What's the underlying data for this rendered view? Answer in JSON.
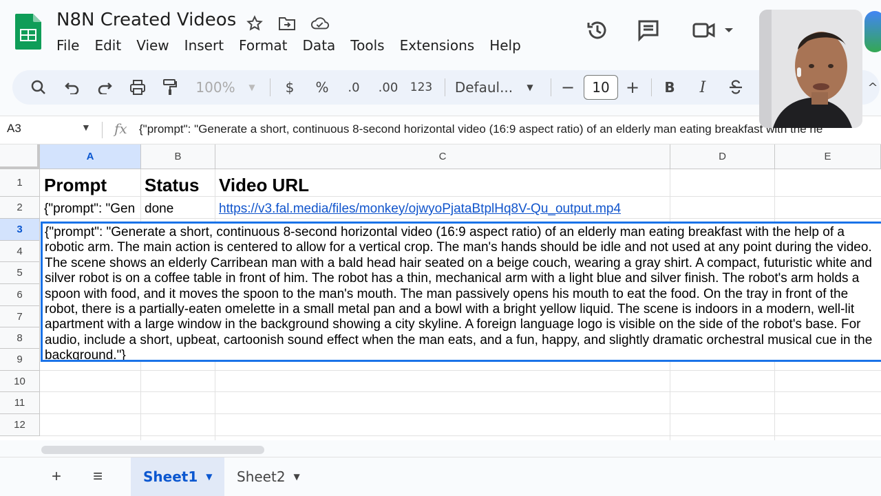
{
  "app": {
    "title": "N8N Created Videos",
    "icons": [
      "sheets-logo-icon",
      "star-icon",
      "move-to-folder-icon",
      "cloud-saved-icon"
    ]
  },
  "menu": [
    "File",
    "Edit",
    "View",
    "Insert",
    "Format",
    "Data",
    "Tools",
    "Extensions",
    "Help"
  ],
  "header_actions": [
    "history-icon",
    "comments-icon",
    "meet-icon",
    "meet-dropdown-icon"
  ],
  "toolbar": {
    "zoom": "100%",
    "currency": "$",
    "percent": "%",
    "decrease_decimals": ".0",
    "increase_decimals": ".00",
    "number_format": "123",
    "font": "Defaul...",
    "font_size": "10",
    "minus": "−",
    "plus": "+",
    "bold": "B",
    "italic": "I",
    "collapse": "^"
  },
  "formula_bar": {
    "name_box": "A3",
    "fx": "fx",
    "content": "{\"prompt\": \"Generate a short, continuous 8-second horizontal video (16:9 aspect ratio) of an elderly man eating breakfast with the he"
  },
  "columns": [
    "A",
    "B",
    "C",
    "D",
    "E"
  ],
  "rows": [
    "1",
    "2",
    "3",
    "4",
    "5",
    "6",
    "7",
    "8",
    "9",
    "10",
    "11",
    "12"
  ],
  "cells": {
    "a1": "Prompt",
    "b1": "Status",
    "c1": "Video URL",
    "a2": "{\"prompt\": \"Gen",
    "b2": "done",
    "c2": "https://v3.fal.media/files/monkey/ojwyoPjataBtplHq8V-Qu_output.mp4",
    "a3": "{\"prompt\": \"Generate a short, continuous 8-second horizontal video (16:9 aspect ratio) of an elderly man eating breakfast with the help of a\nrobotic arm. The main action is centered to allow for a vertical crop. The man's hands should be idle and not used at any point during the video.\nThe scene shows an elderly Carribean man with a bald head hair seated on a beige couch, wearing a gray shirt. A compact, futuristic white and\nsilver robot is on a coffee table in front of him. The robot has a thin, mechanical arm with a light blue and silver finish. The robot's arm holds a\nspoon with food, and it moves the spoon to the man's mouth. The man passively opens his mouth to eat the food. On the tray in front of the\nrobot, there is a partially-eaten omelette in a small metal pan and a bowl with a bright yellow liquid. The scene is indoors in a modern, well-lit\napartment with a large window in the background showing a city skyline. A foreign language logo is visible on the side of the robot's base. For\naudio, include a short, upbeat, cartoonish sound effect when the man eats, and a fun, happy, and slightly dramatic orchestral musical cue in the\nbackground.\"}"
  },
  "sheets": {
    "add_icon": "+",
    "list_icon": "≡",
    "tabs": [
      "Sheet1",
      "Sheet2"
    ],
    "active": "Sheet1"
  },
  "colors": {
    "accent": "#0b57d0",
    "selection": "#1a73e8",
    "link": "#1155cc",
    "toolbar_bg": "#edf2fa",
    "logo_green": "#0f9d58"
  }
}
